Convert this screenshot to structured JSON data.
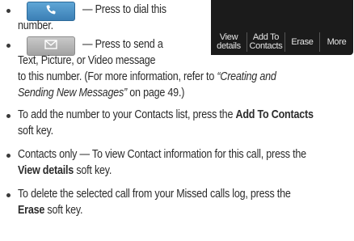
{
  "item_call": {
    "dash_text": "— Press to dial this",
    "line2": "number."
  },
  "item_message": {
    "dash_text": "— Press to send a",
    "line2": "Text, Picture, or Video message",
    "line3": "to this number. (For more information, refer to ",
    "line3_link": "“Creating and",
    "line4_link": "Sending New Messages”",
    "line4_rest": " on page 49.)"
  },
  "softkeys": [
    {
      "label_line1": "View",
      "label_line2": "details"
    },
    {
      "label_line1": "Add To",
      "label_line2": "Contacts"
    },
    {
      "label_line1": "Erase",
      "label_line2": ""
    },
    {
      "label_line1": "More",
      "label_line2": ""
    }
  ],
  "bullets": [
    {
      "pre": "To add the number to your Contacts list, press the ",
      "bold": "Add To Contacts",
      "line2": "soft key."
    },
    {
      "pre": "Contacts only — To view Contact information for this call, press the",
      "bold_line2": "View details",
      "post_line2": " soft key."
    },
    {
      "pre": "To delete the selected call from your Missed calls log, press the",
      "bold_line2": "Erase",
      "post_line2": " soft key."
    }
  ],
  "icons": {
    "call": "phone-handset-icon",
    "message": "envelope-icon"
  },
  "colors": {
    "call_button": "#4a8fc4",
    "message_button": "#b4b4b4",
    "panel": "#1b1b1b"
  }
}
